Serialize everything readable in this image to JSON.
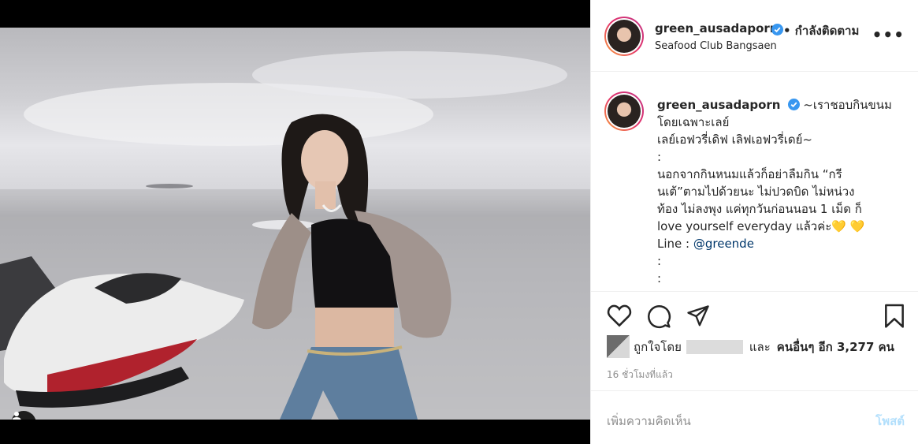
{
  "post": {
    "username": "green_ausadaporn",
    "follow_status": "• กำลังติดตาม",
    "location": "Seafood Club Bangsaen",
    "more_label": "•••"
  },
  "caption": {
    "username": "green_ausadaporn",
    "lines": [
      "~เราชอบกินขนม",
      "โดยเฉพาะเลย์",
      "เลย์เอฟวรี่เดิฟ เลิฟเอฟวรี่เดย์~",
      ":",
      "นอกจากกินหนมแล้วก็อย่าลืมกิน “กรี",
      "นเต้”ตามไปด้วยนะ ไม่ปวดบิด ไม่หน่วง",
      "ท้อง ไม่ลงพุง แค่ทุกวันก่อนนอน 1 เม็ด ก็",
      "love yourself everyday แล้วค่ะ",
      ":",
      ":"
    ],
    "hearts": "💛 💛",
    "line_label": "Line : ",
    "line_handle": "@greende"
  },
  "likes": {
    "prefix": "ถูกใจโดย",
    "and": "และ",
    "others": "คนอื่นๆ อีก 3,277 คน"
  },
  "time": "16 ชั่วโมงที่แล้ว",
  "comment": {
    "placeholder": "เพิ่มความคิดเห็น",
    "post_label": "โพสต์"
  },
  "icons": {
    "like": "heart-icon",
    "comment": "comment-icon",
    "share": "share-icon",
    "save": "bookmark-icon",
    "verified": "verified-badge-icon",
    "tag": "user-tag-icon"
  },
  "colors": {
    "verified": "#3897f0",
    "post_button": "#b2dffc",
    "muted_text": "#8e8e8e",
    "link": "#00376b"
  }
}
